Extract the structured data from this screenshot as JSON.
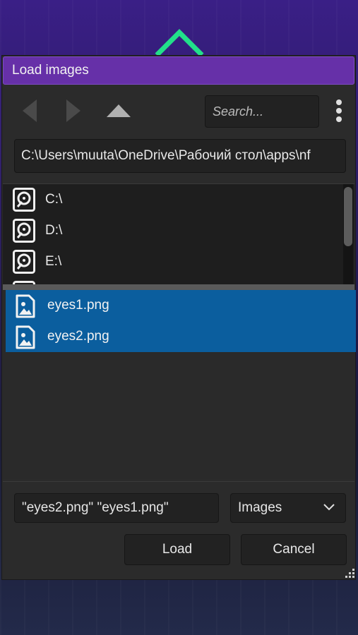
{
  "background": {
    "accent_color": "#22e08a",
    "decoration": "chevron-up-icon"
  },
  "dialog": {
    "title": "Load images",
    "title_color": "#6630a8"
  },
  "toolbar": {
    "back_icon": "chevron-left-icon",
    "forward_icon": "chevron-right-icon",
    "up_icon": "triangle-up-icon",
    "search_placeholder": "Search...",
    "menu_icon": "kebab-menu-icon"
  },
  "path": {
    "value": "C:\\Users\\muuta\\OneDrive\\Рабочий стол\\apps\\nf"
  },
  "drives": {
    "items": [
      {
        "label": "C:\\",
        "icon": "hard-drive-icon"
      },
      {
        "label": "D:\\",
        "icon": "hard-drive-icon"
      },
      {
        "label": "E:\\",
        "icon": "hard-drive-icon"
      }
    ]
  },
  "files": {
    "selection_color": "#0b5e9e",
    "items": [
      {
        "label": "eyes1.png",
        "icon": "image-file-icon",
        "selected": true
      },
      {
        "label": "eyes2.png",
        "icon": "image-file-icon",
        "selected": true
      }
    ]
  },
  "footer": {
    "filename_value": "\"eyes2.png\" \"eyes1.png\"",
    "filetype_value": "Images",
    "load_label": "Load",
    "cancel_label": "Cancel"
  }
}
